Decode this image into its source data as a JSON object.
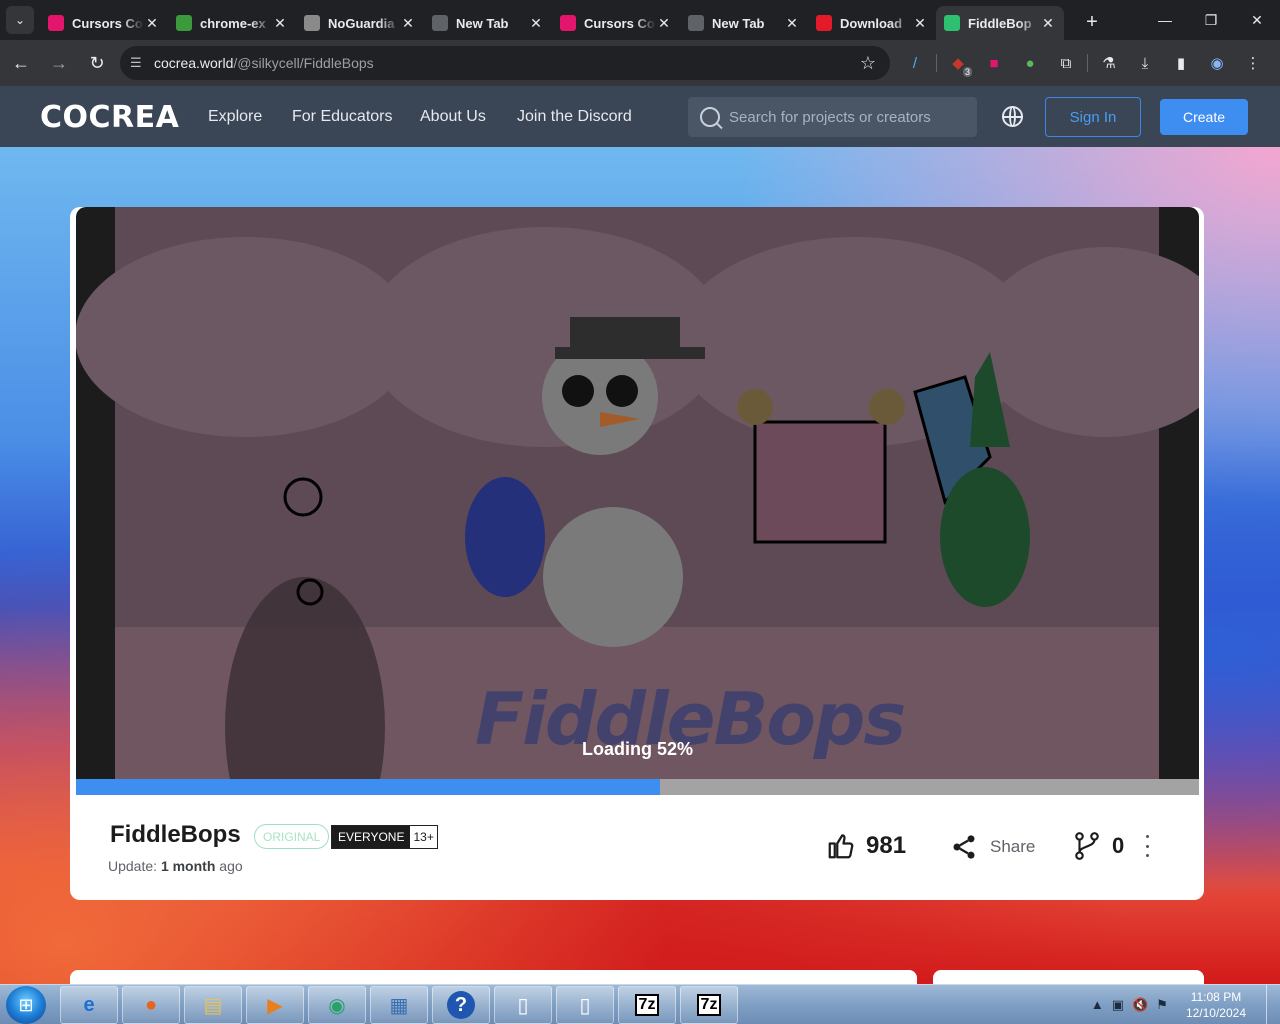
{
  "browser": {
    "tabs": [
      {
        "title": "Cursors Co",
        "favicon": "cursor-icon",
        "color": "#e3156d"
      },
      {
        "title": "chrome-ex",
        "favicon": "android-icon",
        "color": "#3c9a3c"
      },
      {
        "title": "NoGuardia",
        "favicon": "image-icon",
        "color": "#8a8a8a"
      },
      {
        "title": "New Tab",
        "favicon": "globe-icon",
        "color": "#5f6368"
      },
      {
        "title": "Cursors Co",
        "favicon": "cursor-icon",
        "color": "#e3156d"
      },
      {
        "title": "New Tab",
        "favicon": "globe-icon",
        "color": "#5f6368"
      },
      {
        "title": "Download",
        "favicon": "m-icon",
        "color": "#e31a2a"
      },
      {
        "title": "FiddleBop",
        "favicon": "cocrea-icon",
        "color": "#2fbf71",
        "active": true
      }
    ],
    "address": {
      "host": "cocrea.world",
      "path": "/@silkycell/FiddleBops"
    }
  },
  "site": {
    "logo": "COCREA",
    "nav": [
      "Explore",
      "For Educators",
      "About Us",
      "Join the Discord"
    ],
    "search_placeholder": "Search for projects or creators",
    "sign_in": "Sign In",
    "create": "Create"
  },
  "player": {
    "loading_text": "Loading 52%",
    "progress_percent": 52,
    "splash_title": "FiddleBops"
  },
  "project": {
    "title": "FiddleBops",
    "original_badge": "ORIGINAL",
    "rating": "EVERYONE",
    "age": "13+",
    "update_prefix": "Update:",
    "update_value": "1 month",
    "update_suffix": "ago",
    "likes": "981",
    "share_label": "Share",
    "remixes": "0"
  },
  "taskbar": {
    "time": "11:08 PM",
    "date": "12/10/2024"
  }
}
